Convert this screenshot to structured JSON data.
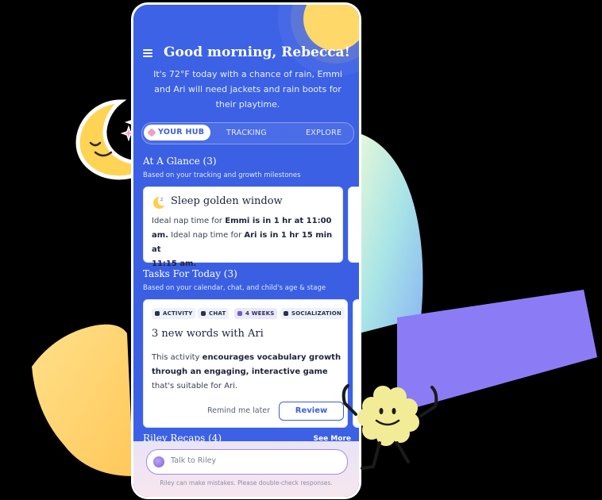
{
  "header": {
    "greeting": "Good morning, Rebecca!",
    "message": "It's 72°F today with a chance of rain, Emmi and Ari will need jackets and rain boots for their playtime."
  },
  "tabs": [
    {
      "label": "YOUR HUB",
      "active": true
    },
    {
      "label": "TRACKING",
      "active": false
    },
    {
      "label": "EXPLORE",
      "active": false
    }
  ],
  "glance": {
    "title": "At A Glance (3)",
    "subtitle": "Based on your tracking and growth milestones",
    "card": {
      "title": "Sleep golden window",
      "line1_a": "Ideal nap time for ",
      "line1_b": "Emmi is in 1 hr at 11:00",
      "line2_a": "am.",
      "line2_b": " Ideal nap time for ",
      "line2_c": "Ari is in 1 hr 15 min at",
      "line3": "11:15 am."
    }
  },
  "tasks": {
    "title": "Tasks For Today (3)",
    "subtitle": "Based on your calendar, chat, and child's age & stage",
    "card": {
      "tags": [
        "ACTIVITY",
        "CHAT",
        "4 WEEKS",
        "SOCIALIZATION"
      ],
      "title": "3 new words with Ari",
      "body_a": "This activity ",
      "body_b": "encourages vocabulary growth through an engaging, interactive game",
      "body_c": " that's suitable for Ari.",
      "remind_label": "Remind me later",
      "review_label": "Review"
    }
  },
  "recaps": {
    "title": "Riley Recaps (4)",
    "see_more": "See More"
  },
  "chat": {
    "placeholder": "Talk to Riley",
    "disclaimer": "Riley can make mistakes. Please double-check responses."
  },
  "colors": {
    "primary": "#3b5fe0",
    "sun": "#ffd86a",
    "purple_shape": "#8b7cf6",
    "yellow_shape": "#ffd36b"
  }
}
